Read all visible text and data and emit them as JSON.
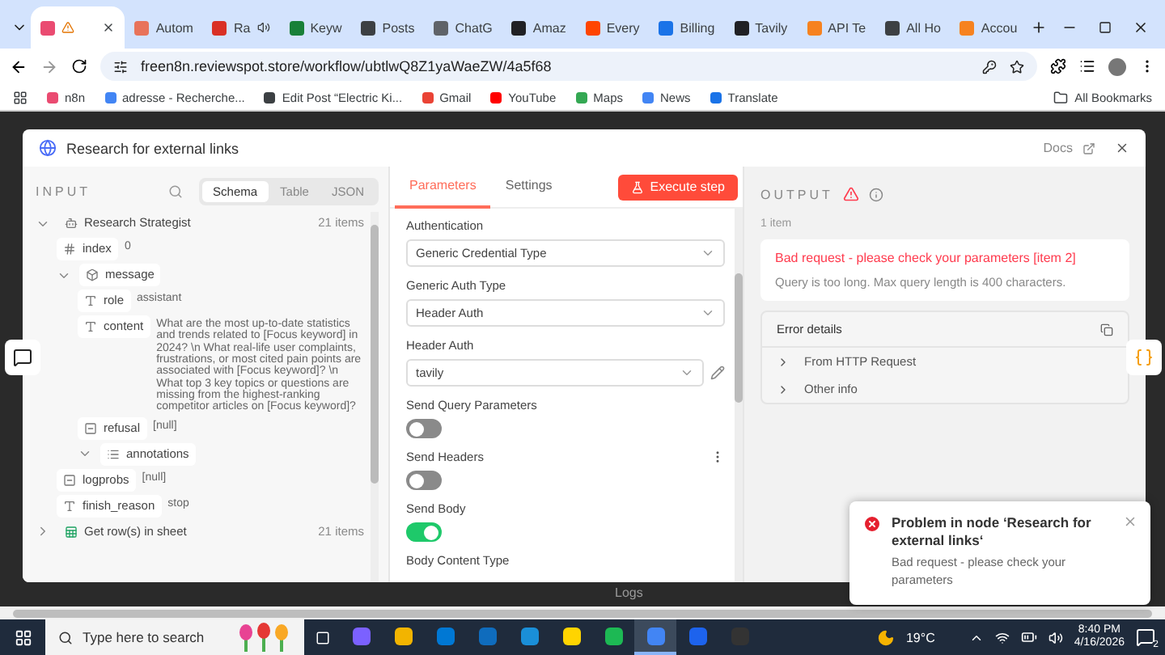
{
  "browser": {
    "tabs": [
      {
        "selected": true,
        "color": "#ea4b71",
        "audio": false
      },
      {
        "label": "Autom",
        "selected": false,
        "color": "#e8735a",
        "audio": false
      },
      {
        "label": "Ra",
        "selected": false,
        "color": "#d93025",
        "audio": true
      },
      {
        "label": "Keyw",
        "selected": false,
        "color": "#188038",
        "audio": false
      },
      {
        "label": "Posts",
        "selected": false,
        "color": "#3c4043",
        "audio": false
      },
      {
        "label": "ChatG",
        "selected": false,
        "color": "#5f6368",
        "audio": false
      },
      {
        "label": "Amaz",
        "selected": false,
        "color": "#202124",
        "audio": false
      },
      {
        "label": "Every",
        "selected": false,
        "color": "#ff4500",
        "audio": false
      },
      {
        "label": "Billing",
        "selected": false,
        "color": "#1a73e8",
        "audio": false
      },
      {
        "label": "Tavily",
        "selected": false,
        "color": "#202124",
        "audio": false
      },
      {
        "label": "API Te",
        "selected": false,
        "color": "#f6821f",
        "audio": false
      },
      {
        "label": "All Ho",
        "selected": false,
        "color": "#3c4043",
        "audio": false
      },
      {
        "label": "Accou",
        "selected": false,
        "color": "#f6821f",
        "audio": false
      }
    ],
    "address": "freen8n.reviewspot.store/workflow/ubtlwQ8Z1yaWaeZW/4a5f68",
    "bookmarks": [
      {
        "label": "n8n",
        "color": "#ea4b71"
      },
      {
        "label": "adresse - Recherche...",
        "color": "#4285f4"
      },
      {
        "label": "Edit Post “Electric Ki...",
        "color": "#3c4043"
      },
      {
        "label": "Gmail",
        "color": "#ea4335"
      },
      {
        "label": "YouTube",
        "color": "#ff0000"
      },
      {
        "label": "Maps",
        "color": "#34a853"
      },
      {
        "label": "News",
        "color": "#4285f4"
      },
      {
        "label": "Translate",
        "color": "#1a73e8"
      }
    ],
    "all_bookmarks": "All Bookmarks"
  },
  "canvas": {
    "logs_label": "Logs"
  },
  "node_dialog": {
    "title": "Research for external links",
    "docs_link": "Docs",
    "input": {
      "heading": "INPUT",
      "view_tabs": [
        {
          "label": "Schema",
          "selected": true
        },
        {
          "label": "Table",
          "selected": false
        },
        {
          "label": "JSON",
          "selected": false
        }
      ],
      "tree": [
        {
          "kind": "node",
          "name": "Research Strategist",
          "count": "21 items",
          "expanded": true,
          "children": [
            {
              "kind": "number",
              "name": "index",
              "value": "0"
            },
            {
              "kind": "object",
              "name": "message",
              "expanded": true,
              "children": [
                {
                  "kind": "text",
                  "name": "role",
                  "value": "assistant"
                },
                {
                  "kind": "text",
                  "name": "content",
                  "value": "What are the most up-to-date statistics and trends related to [Focus keyword] in 2024? \\n What real-life user complaints, frustrations, or most cited pain points are associated with [Focus keyword]? \\n What top 3 key topics or questions are missing from the highest-ranking competitor articles on [Focus keyword]?"
                },
                {
                  "kind": "null",
                  "name": "refusal",
                  "value": "[null]"
                },
                {
                  "kind": "list",
                  "name": "annotations",
                  "expanded": true
                }
              ]
            },
            {
              "kind": "null",
              "name": "logprobs",
              "value": "[null]"
            },
            {
              "kind": "text",
              "name": "finish_reason",
              "value": "stop"
            }
          ]
        },
        {
          "kind": "sheet",
          "name": "Get row(s) in sheet",
          "count": "21 items",
          "expanded": false
        }
      ]
    },
    "parameters": {
      "tabs": [
        {
          "label": "Parameters",
          "selected": true
        },
        {
          "label": "Settings",
          "selected": false
        }
      ],
      "execute_button": "Execute step",
      "fields": [
        {
          "kind": "select",
          "label": "Authentication",
          "value": "Generic Credential Type"
        },
        {
          "kind": "select",
          "label": "Generic Auth Type",
          "value": "Header Auth"
        },
        {
          "kind": "credential",
          "label": "Header Auth",
          "value": "tavily"
        },
        {
          "kind": "toggle",
          "label": "Send Query Parameters",
          "on": false
        },
        {
          "kind": "toggle",
          "label": "Send Headers",
          "on": false,
          "options": true
        },
        {
          "kind": "toggle",
          "label": "Send Body",
          "on": true
        },
        {
          "kind": "label",
          "label": "Body Content Type"
        }
      ]
    },
    "output": {
      "heading": "OUTPUT",
      "count": "1 item",
      "error": {
        "title": "Bad request - please check your parameters [item 2]",
        "message": "Query is too long. Max query length is 400 characters."
      },
      "details": {
        "title": "Error details",
        "rows": [
          "From HTTP Request",
          "Other info"
        ]
      }
    }
  },
  "toast": {
    "title": "Problem in node ‘Research for external links‘",
    "message": "Bad request - please check your parameters"
  },
  "taskbar": {
    "search_placeholder": "Type here to search",
    "apps": [
      {
        "color": "#7b61ff",
        "selected": false
      },
      {
        "color": "#f2b400",
        "selected": false
      },
      {
        "color": "#0078d4",
        "selected": false
      },
      {
        "color": "#0f6cbd",
        "selected": false
      },
      {
        "color": "#1a8fd8",
        "selected": false
      },
      {
        "color": "#ffd400",
        "selected": false
      },
      {
        "color": "#1db954",
        "selected": false
      },
      {
        "color": "#4285f4",
        "selected": true
      },
      {
        "color": "#1d63ed",
        "selected": false
      },
      {
        "color": "#333333",
        "selected": false
      }
    ],
    "temperature": "19°C",
    "time": "8:40 PM",
    "date": "4/16/2026",
    "notifications": "2"
  }
}
